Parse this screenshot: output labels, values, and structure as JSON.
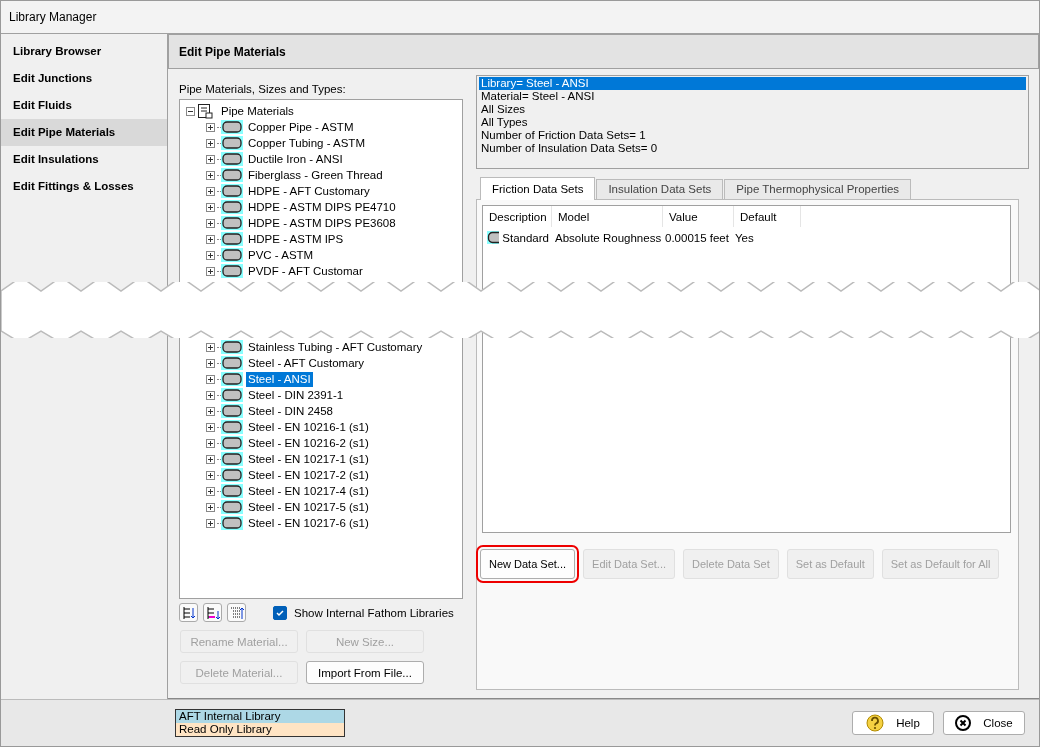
{
  "window": {
    "title": "Library Manager"
  },
  "sidebar": {
    "items": [
      {
        "label": "Library Browser",
        "selected": false
      },
      {
        "label": "Edit Junctions",
        "selected": false
      },
      {
        "label": "Edit Fluids",
        "selected": false
      },
      {
        "label": "Edit Pipe Materials",
        "selected": true
      },
      {
        "label": "Edit Insulations",
        "selected": false
      },
      {
        "label": "Edit Fittings & Losses",
        "selected": false
      }
    ]
  },
  "panel": {
    "title": "Edit Pipe Materials"
  },
  "tree": {
    "caption": "Pipe Materials, Sizes and Types:",
    "label": "Pipe Materials",
    "expanded": true,
    "children": [
      {
        "label": "Copper Pipe - ASTM",
        "selected": false
      },
      {
        "label": "Copper Tubing - ASTM",
        "selected": false
      },
      {
        "label": "Ductile Iron - ANSI",
        "selected": false
      },
      {
        "label": "Fiberglass - Green Thread",
        "selected": false
      },
      {
        "label": "HDPE - AFT Customary",
        "selected": false
      },
      {
        "label": "HDPE - ASTM DIPS PE4710",
        "selected": false
      },
      {
        "label": "HDPE - ASTM DIPS PE3608",
        "selected": false
      },
      {
        "label": "HDPE - ASTM IPS",
        "selected": false
      },
      {
        "label": "PVC - ASTM",
        "selected": false
      },
      {
        "label": "PVDF - AFT Customar",
        "selected": false
      }
    ],
    "children_below_cut": [
      {
        "label": "Stainless Tubing - AFT Customary",
        "selected": false
      },
      {
        "label": "Steel - AFT Customary",
        "selected": false
      },
      {
        "label": "Steel - ANSI",
        "selected": true
      },
      {
        "label": "Steel - DIN 2391-1",
        "selected": false
      },
      {
        "label": "Steel - DIN 2458",
        "selected": false
      },
      {
        "label": "Steel - EN 10216-1 (s1)",
        "selected": false
      },
      {
        "label": "Steel - EN 10216-2 (s1)",
        "selected": false
      },
      {
        "label": "Steel - EN 10217-1 (s1)",
        "selected": false
      },
      {
        "label": "Steel - EN 10217-2 (s1)",
        "selected": false
      },
      {
        "label": "Steel - EN 10217-4 (s1)",
        "selected": false
      },
      {
        "label": "Steel - EN 10217-5 (s1)",
        "selected": false
      },
      {
        "label": "Steel - EN 10217-6 (s1)",
        "selected": false
      }
    ]
  },
  "show_internal": {
    "label": "Show Internal Fathom Libraries",
    "checked": true
  },
  "material_buttons": [
    {
      "label": "Rename Material...",
      "disabled": true
    },
    {
      "label": "New Size...",
      "disabled": true
    },
    {
      "label": "Delete Material...",
      "disabled": true
    },
    {
      "label": "Import From File...",
      "disabled": false
    }
  ],
  "info": [
    {
      "text": "Library= Steel - ANSI",
      "selected": true
    },
    {
      "text": "Material= Steel - ANSI",
      "selected": false
    },
    {
      "text": "All Sizes",
      "selected": false
    },
    {
      "text": "All Types",
      "selected": false
    },
    {
      "text": "Number of Friction Data Sets= 1",
      "selected": false
    },
    {
      "text": "Number of Insulation Data Sets= 0",
      "selected": false
    }
  ],
  "tabs": [
    {
      "label": "Friction Data Sets",
      "selected": true
    },
    {
      "label": "Insulation Data Sets",
      "selected": false
    },
    {
      "label": "Pipe Thermophysical Properties",
      "selected": false
    }
  ],
  "table": {
    "columns": [
      "Description",
      "Model",
      "Value",
      "Default"
    ],
    "rows": [
      [
        "Standard",
        "Absolute Roughness",
        "0.00015 feet",
        "Yes"
      ]
    ]
  },
  "data_set_buttons": [
    {
      "label": "New Data Set...",
      "disabled": false,
      "highlighted": true
    },
    {
      "label": "Edit Data Set...",
      "disabled": true,
      "highlighted": false
    },
    {
      "label": "Delete Data Set",
      "disabled": true,
      "highlighted": false
    },
    {
      "label": "Set as Default",
      "disabled": true,
      "highlighted": false
    },
    {
      "label": "Set as Default for All",
      "disabled": true,
      "highlighted": false
    }
  ],
  "legend": [
    {
      "label": "AFT Internal Library",
      "color": "#add8e6"
    },
    {
      "label": "Read Only Library",
      "color": "#ffe4c4"
    }
  ],
  "footer_buttons": [
    {
      "label": "Help",
      "kind": "help"
    },
    {
      "label": "Close",
      "kind": "close"
    }
  ]
}
